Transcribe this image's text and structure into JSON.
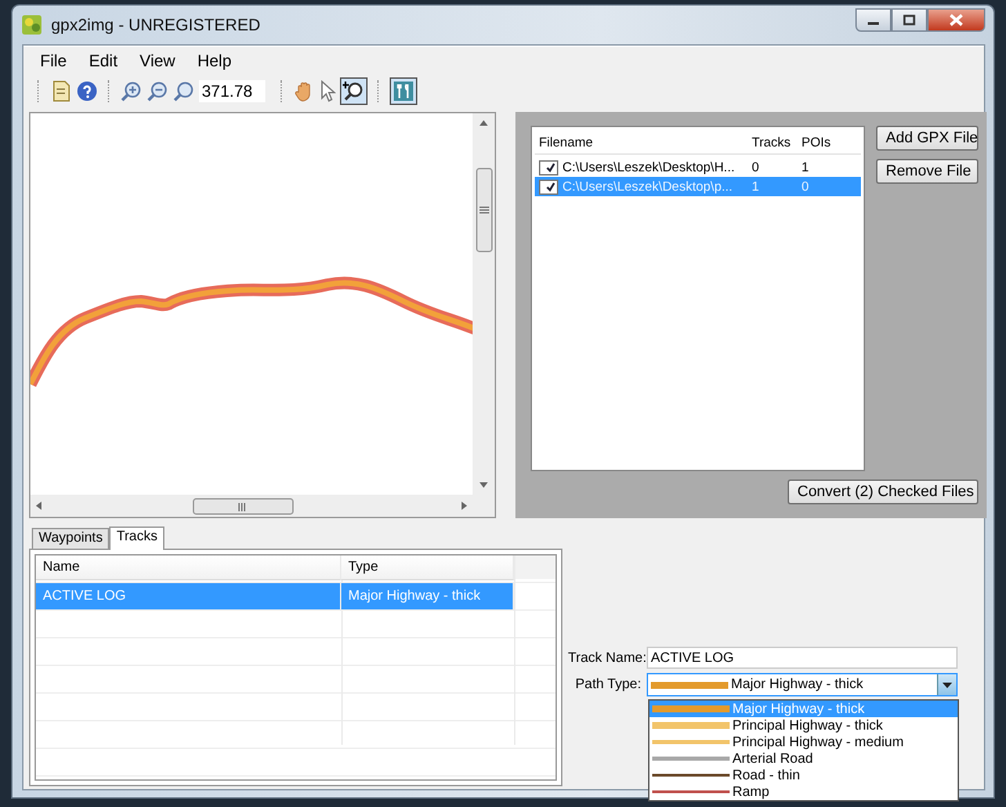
{
  "window": {
    "title": "gpx2img - UNREGISTERED"
  },
  "menu": [
    "File",
    "Edit",
    "View",
    "Help"
  ],
  "toolbar": {
    "zoom_value": "371.78"
  },
  "files": {
    "columns": [
      "Filename",
      "Tracks",
      "POIs"
    ],
    "rows": [
      {
        "filename": "C:\\Users\\Leszek\\Desktop\\H...",
        "tracks": "0",
        "pois": "1",
        "checked": true,
        "selected": false
      },
      {
        "filename": "C:\\Users\\Leszek\\Desktop\\p...",
        "tracks": "1",
        "pois": "0",
        "checked": true,
        "selected": true
      }
    ]
  },
  "file_buttons": [
    "Add GPX File",
    "Remove File"
  ],
  "convert_button": "Convert (2) Checked Files",
  "tabs": [
    {
      "label": "Waypoints",
      "selected": false
    },
    {
      "label": "Tracks",
      "selected": true
    }
  ],
  "tracks": {
    "columns": [
      "Name",
      "Type"
    ],
    "rows": [
      {
        "name": "ACTIVE LOG",
        "type": "Major Highway - thick",
        "selected": true
      }
    ]
  },
  "track_name": {
    "label": "Track Name:",
    "value": "ACTIVE LOG"
  },
  "path_type": {
    "label": "Path Type:",
    "value": "Major Highway - thick",
    "color": "#e39a2c",
    "kind": "thick",
    "expanded": true,
    "options": [
      {
        "label": "Major Highway - thick",
        "color": "#e39a2c",
        "kind": "thick",
        "selected": true
      },
      {
        "label": "Principal Highway - thick",
        "color": "#f2c46a",
        "kind": "thick",
        "selected": false
      },
      {
        "label": "Principal Highway - medium",
        "color": "#f2c46a",
        "kind": "medium",
        "selected": false
      },
      {
        "label": "Arterial Road",
        "color": "#a8a8a8",
        "kind": "medium",
        "selected": false
      },
      {
        "label": "Road - thin",
        "color": "#6b4a2a",
        "kind": "thin",
        "selected": false
      },
      {
        "label": "Ramp",
        "color": "#c0504d",
        "kind": "thin",
        "selected": false
      }
    ]
  }
}
